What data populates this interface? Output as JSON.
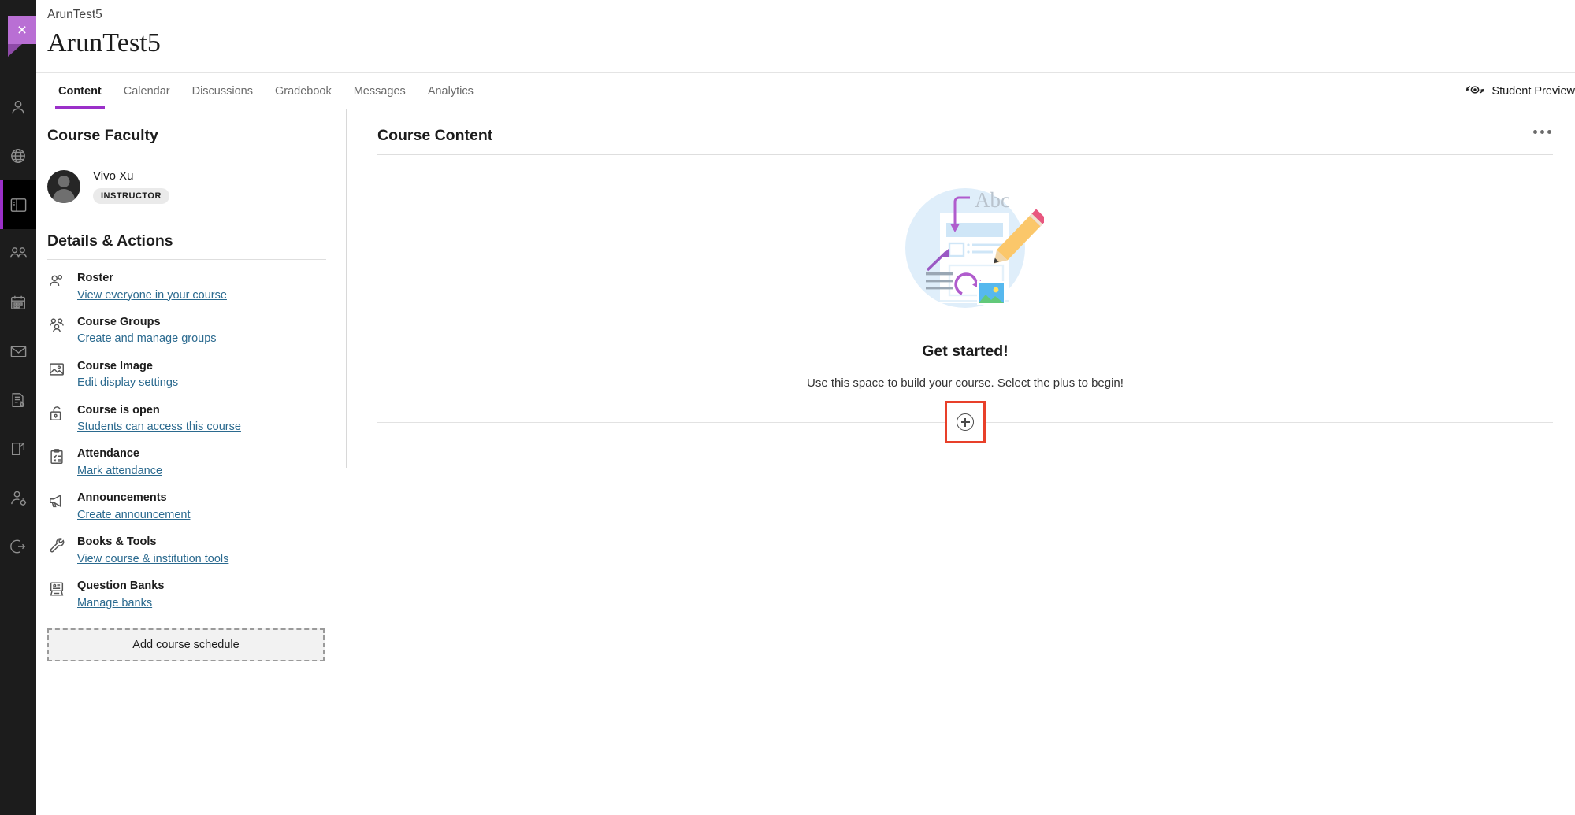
{
  "window": {
    "close_label": "×"
  },
  "rail": {
    "items": [
      {
        "name": "profile",
        "icon": "person-icon",
        "active": false
      },
      {
        "name": "institution-page",
        "icon": "globe-icon",
        "active": false
      },
      {
        "name": "courses",
        "icon": "courses-icon",
        "active": true
      },
      {
        "name": "organizations",
        "icon": "people-group-icon",
        "active": false
      },
      {
        "name": "calendar",
        "icon": "calendar-icon",
        "active": false
      },
      {
        "name": "messages",
        "icon": "envelope-icon",
        "active": false
      },
      {
        "name": "grades",
        "icon": "document-pencil-icon",
        "active": false
      },
      {
        "name": "tools",
        "icon": "edit-square-icon",
        "active": false
      },
      {
        "name": "admin",
        "icon": "person-gear-icon",
        "active": false
      },
      {
        "name": "sign-out",
        "icon": "sign-out-icon",
        "active": false
      }
    ]
  },
  "header": {
    "breadcrumb": "ArunTest5",
    "title": "ArunTest5"
  },
  "tabs": [
    {
      "label": "Content",
      "active": true
    },
    {
      "label": "Calendar",
      "active": false
    },
    {
      "label": "Discussions",
      "active": false
    },
    {
      "label": "Gradebook",
      "active": false
    },
    {
      "label": "Messages",
      "active": false
    },
    {
      "label": "Analytics",
      "active": false
    }
  ],
  "student_preview": {
    "label": "Student Preview",
    "icon": "student-preview-icon"
  },
  "left_panel": {
    "faculty_heading": "Course Faculty",
    "faculty": {
      "name": "Vivo Xu",
      "role": "INSTRUCTOR"
    },
    "details_heading": "Details & Actions",
    "details": [
      {
        "icon": "roster-icon",
        "title": "Roster",
        "link": "View everyone in your course"
      },
      {
        "icon": "groups-icon",
        "title": "Course Groups",
        "link": "Create and manage groups"
      },
      {
        "icon": "image-icon",
        "title": "Course Image",
        "link": "Edit display settings"
      },
      {
        "icon": "unlock-icon",
        "title": "Course is open",
        "link": "Students can access this course"
      },
      {
        "icon": "clipboard-check-icon",
        "title": "Attendance",
        "link": "Mark attendance"
      },
      {
        "icon": "megaphone-icon",
        "title": "Announcements",
        "link": "Create announcement"
      },
      {
        "icon": "wrench-icon",
        "title": "Books & Tools",
        "link": "View course & institution tools"
      },
      {
        "icon": "question-bank-icon",
        "title": "Question Banks",
        "link": "Manage banks"
      }
    ],
    "add_schedule_label": "Add course schedule"
  },
  "content": {
    "title": "Course Content",
    "overflow_menu": "more-options",
    "empty_state": {
      "illustration": "course-content-illustration",
      "illustration_text": "Abc",
      "heading": "Get started!",
      "subtext": "Use this space to build your course. Select the plus to begin!",
      "add_button": "add-content-button"
    }
  },
  "colors": {
    "brand_purple": "#9b30c9",
    "link_blue": "#2b6a8f",
    "highlight_red": "#e8402a",
    "rail_bg": "#1c1c1c"
  }
}
